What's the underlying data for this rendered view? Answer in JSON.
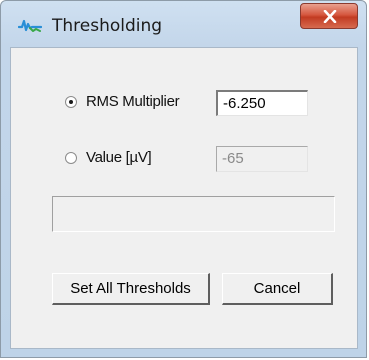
{
  "window": {
    "title": "Thresholding",
    "icon": "waveform-icon",
    "close_label": "x"
  },
  "options": {
    "rms": {
      "label": "RMS Multiplier",
      "selected": true,
      "value": "-6.250"
    },
    "value": {
      "label": "Value [µV]",
      "selected": false,
      "value": "-65"
    }
  },
  "status": {
    "text": ""
  },
  "buttons": {
    "set_all": "Set All Thresholds",
    "cancel": "Cancel"
  },
  "colors": {
    "title_bar": "#c3d6ea",
    "close_button": "#d5573f",
    "client_background": "#f0f0f0"
  }
}
